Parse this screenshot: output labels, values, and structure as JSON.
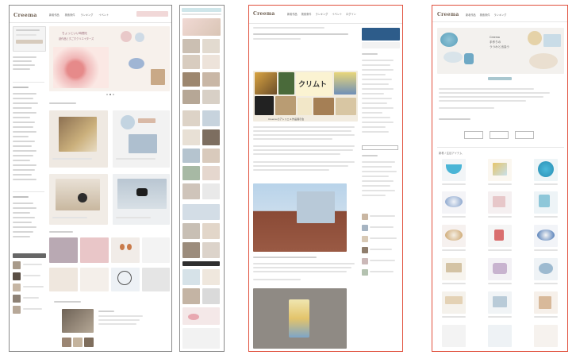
{
  "logo": "Creema",
  "nav": [
    "新着作品",
    "検索条件",
    "ランキング",
    "イベント",
    "ログイン"
  ],
  "hero": {
    "line1": "ちょっといい時間を",
    "line2": "創作品とすごすクリエイターズ"
  },
  "article": {
    "poster_title": "クリムト",
    "poster_sub": "Creema のアトリエ & 作品展示会"
  },
  "shop_hero": {
    "line1": "Creema",
    "line2": "手作りの",
    "line3": "うつわと出会う"
  },
  "section_title": "新着 / 注目アイテム",
  "colors": {
    "frame_gray": "#8a8a8a",
    "frame_red": "#e0503c",
    "logo": "#6d5e50"
  }
}
